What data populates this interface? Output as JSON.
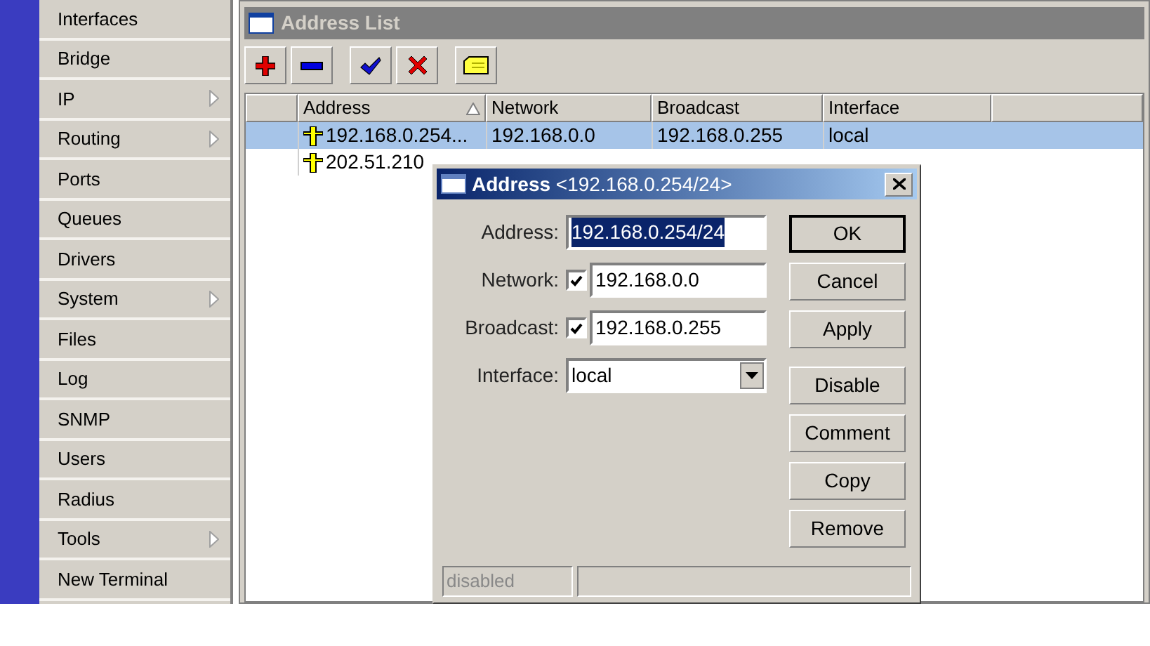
{
  "sidebar": {
    "items": [
      {
        "label": "Interfaces",
        "submenu": false
      },
      {
        "label": "Bridge",
        "submenu": false
      },
      {
        "label": "IP",
        "submenu": true
      },
      {
        "label": "Routing",
        "submenu": true
      },
      {
        "label": "Ports",
        "submenu": false
      },
      {
        "label": "Queues",
        "submenu": false
      },
      {
        "label": "Drivers",
        "submenu": false
      },
      {
        "label": "System",
        "submenu": true
      },
      {
        "label": "Files",
        "submenu": false
      },
      {
        "label": "Log",
        "submenu": false
      },
      {
        "label": "SNMP",
        "submenu": false
      },
      {
        "label": "Users",
        "submenu": false
      },
      {
        "label": "Radius",
        "submenu": false
      },
      {
        "label": "Tools",
        "submenu": true
      },
      {
        "label": "New Terminal",
        "submenu": false
      }
    ]
  },
  "window": {
    "title": "Address List",
    "toolbar": [
      {
        "kind": "add"
      },
      {
        "kind": "remove"
      },
      {
        "kind": "enable"
      },
      {
        "kind": "disable"
      },
      {
        "kind": "comment"
      }
    ],
    "table": {
      "columns": [
        {
          "label": "Address",
          "sorted": true
        },
        {
          "label": "Network",
          "sorted": false
        },
        {
          "label": "Broadcast",
          "sorted": false
        },
        {
          "label": "Interface",
          "sorted": false
        }
      ],
      "rows": [
        {
          "selected": true,
          "cells": [
            "192.168.0.254...",
            "192.168.0.0",
            "192.168.0.255",
            "local"
          ]
        },
        {
          "selected": false,
          "cells": [
            "202.51.210"
          ]
        }
      ]
    }
  },
  "dialog": {
    "title": "Address",
    "subtitle": "<192.168.0.254/24>",
    "fields": [
      {
        "kind": "text",
        "label": "Address:",
        "value": "192.168.0.254/24",
        "highlighted": true
      },
      {
        "kind": "check",
        "label": "Network:",
        "checked": true,
        "value": "192.168.0.0"
      },
      {
        "kind": "check",
        "label": "Broadcast:",
        "checked": true,
        "value": "192.168.0.255"
      },
      {
        "kind": "select",
        "label": "Interface:",
        "value": "local"
      }
    ],
    "buttons": [
      {
        "label": "OK",
        "default": true
      },
      {
        "label": "Cancel",
        "default": false
      },
      {
        "label": "Apply",
        "default": false
      }
    ],
    "more_buttons": [
      {
        "label": "Disable"
      },
      {
        "label": "Comment"
      },
      {
        "label": "Copy"
      },
      {
        "label": "Remove"
      }
    ],
    "status": "disabled"
  }
}
